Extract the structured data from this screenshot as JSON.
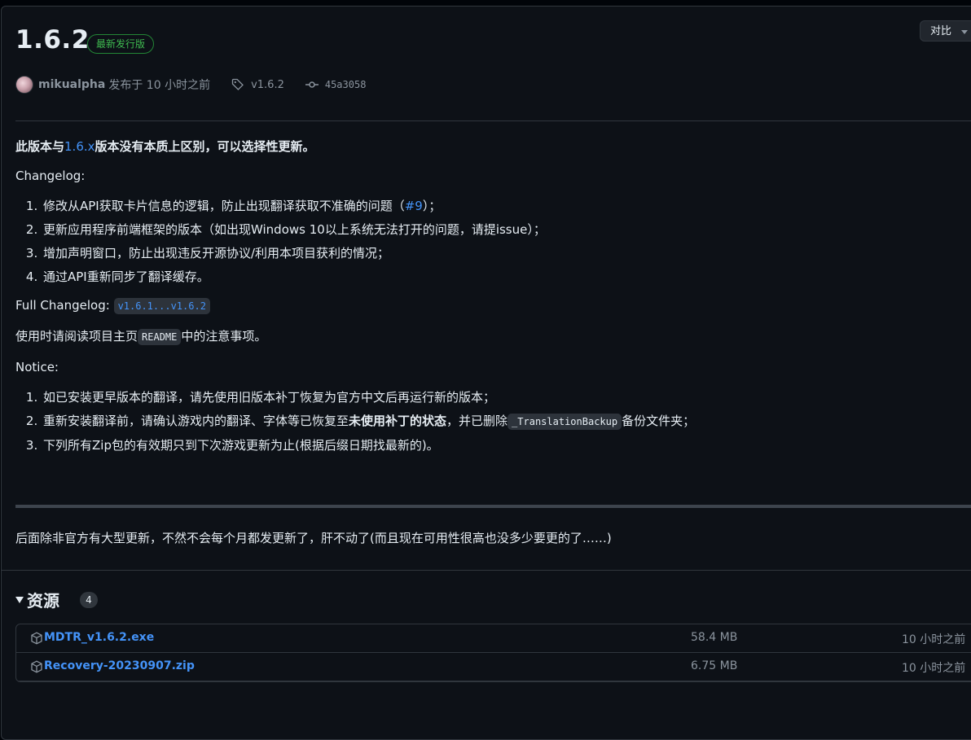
{
  "release": {
    "title": "1.6.2",
    "latest_badge": "最新发行版",
    "compare_label": "对比",
    "author": "mikualpha",
    "published_text": "发布于 10 小时之前",
    "tag": "v1.6.2",
    "commit": "45a3058"
  },
  "body": {
    "intro_prefix": "此版本与",
    "intro_link": "1.6.x",
    "intro_suffix": "版本没有本质上区别，可以选择性更新。",
    "changelog_heading": "Changelog:",
    "changelog_items": [
      {
        "text": "修改从API获取卡片信息的逻辑，防止出现翻译获取不准确的问题（",
        "link": "#9",
        "tail": "）；"
      },
      {
        "text": "更新应用程序前端框架的版本（如出现Windows 10以上系统无法打开的问题，请提issue）；"
      },
      {
        "text": "增加声明窗口，防止出现违反开源协议/利用本项目获利的情况；"
      },
      {
        "text": "通过API重新同步了翻译缓存。"
      }
    ],
    "full_changelog_label": "Full Changelog:",
    "full_changelog_code": "v1.6.1...v1.6.2",
    "readme_prefix": "使用时请阅读项目主页",
    "readme_code": "README",
    "readme_suffix": "中的注意事项。",
    "notice_heading": "Notice:",
    "notice_item1": "如已安装更早版本的翻译，请先使用旧版本补丁恢复为官方中文后再运行新的版本；",
    "notice_item2_prefix": "重新安装翻译前，请确认游戏内的翻译、字体等已恢复至",
    "notice_item2_bold": "未使用补丁的状态",
    "notice_item2_mid": "，并已删除",
    "notice_item2_code": "_TranslationBackup",
    "notice_item2_suffix": "备份文件夹；",
    "notice_item3": "下列所有Zip包的有效期只到下次游戏更新为止(根据后缀日期找最新的)。",
    "footer_note": "后面除非官方有大型更新，不然不会每个月都发更新了，肝不动了(而且现在可用性很高也没多少要更的了……)"
  },
  "assets": {
    "title": "资源",
    "count": "4",
    "rows": [
      {
        "name": "MDTR_v1.6.2.exe",
        "size": "58.4 MB",
        "time": "10 小时之前"
      },
      {
        "name": "Recovery-20230907.zip",
        "size": "6.75 MB",
        "time": "10 小时之前"
      }
    ]
  },
  "colors": {
    "background": "#0d1117",
    "link": "#4493f8",
    "latest_badge": "#3fb950",
    "muted": "#8b949e"
  }
}
